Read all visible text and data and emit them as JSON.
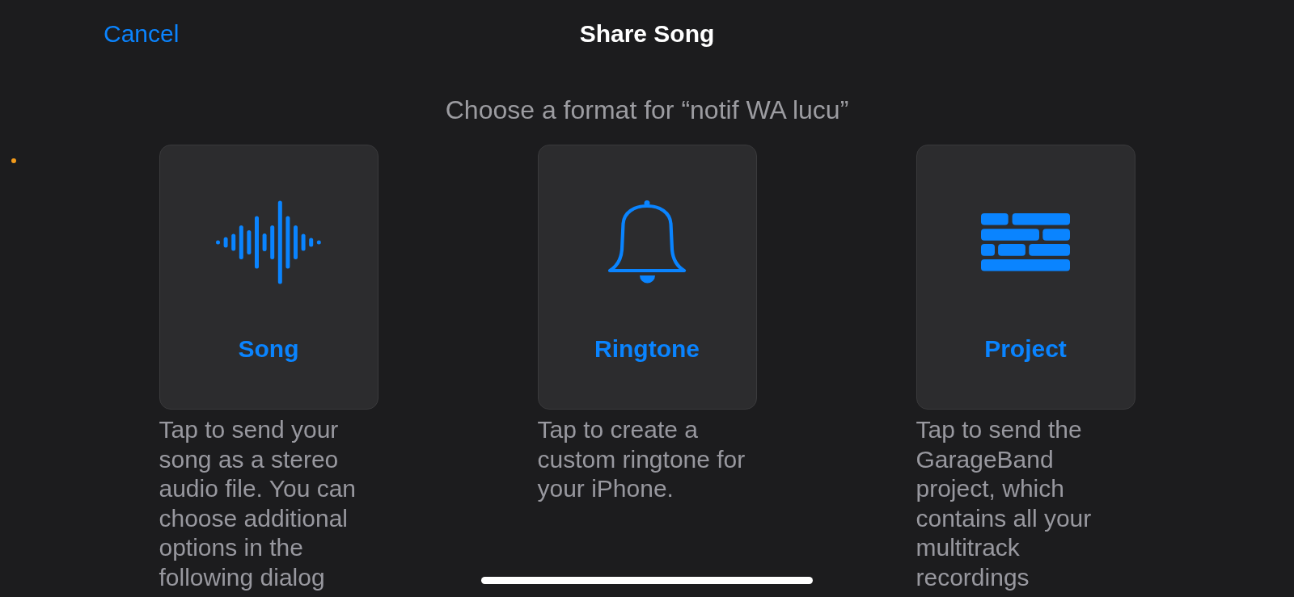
{
  "status": {
    "privacy_indicator": {
      "kind": "microphone"
    }
  },
  "nav_bar": {
    "cancel": "Cancel",
    "title": "Share Song"
  },
  "prompt": "Choose a format for “notif WA lucu”",
  "formats": [
    {
      "kind": "song",
      "label": "Song",
      "description": "Tap to send your song as a stereo audio file. You can choose additional options in the following dialog"
    },
    {
      "kind": "ringtone",
      "label": "Ringtone",
      "description": "Tap to create a custom ringtone for your iPhone."
    },
    {
      "kind": "project",
      "label": "Project",
      "description": "Tap to send the GarageBand project, which contains all your multitrack recordings"
    }
  ]
}
